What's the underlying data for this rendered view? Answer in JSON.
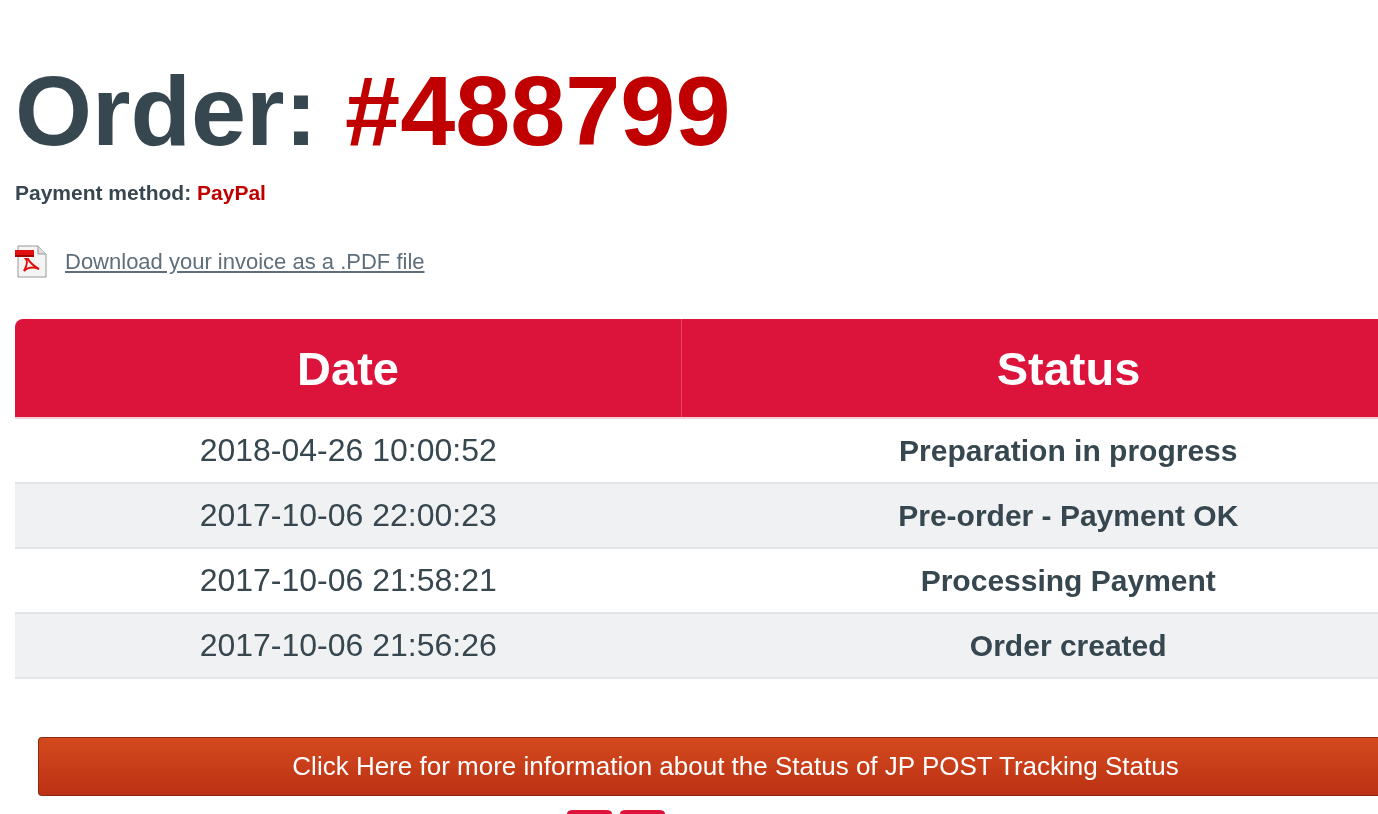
{
  "order": {
    "label": "Order:",
    "number": "#488799"
  },
  "payment": {
    "label": "Payment method:",
    "method": "PayPal"
  },
  "invoice_link": {
    "text": "Download your invoice as a .PDF file"
  },
  "history_table": {
    "columns": [
      "Date",
      "Status"
    ],
    "rows": [
      {
        "date": "2018-04-26 10:00:52",
        "status": "Preparation in progress"
      },
      {
        "date": "2017-10-06 22:00:23",
        "status": "Pre-order - Payment OK"
      },
      {
        "date": "2017-10-06 21:58:21",
        "status": "Processing Payment"
      },
      {
        "date": "2017-10-06 21:56:26",
        "status": "Order created"
      }
    ]
  },
  "tracking_button": {
    "label": "Click Here for more information about the Status of JP POST Tracking Status"
  }
}
